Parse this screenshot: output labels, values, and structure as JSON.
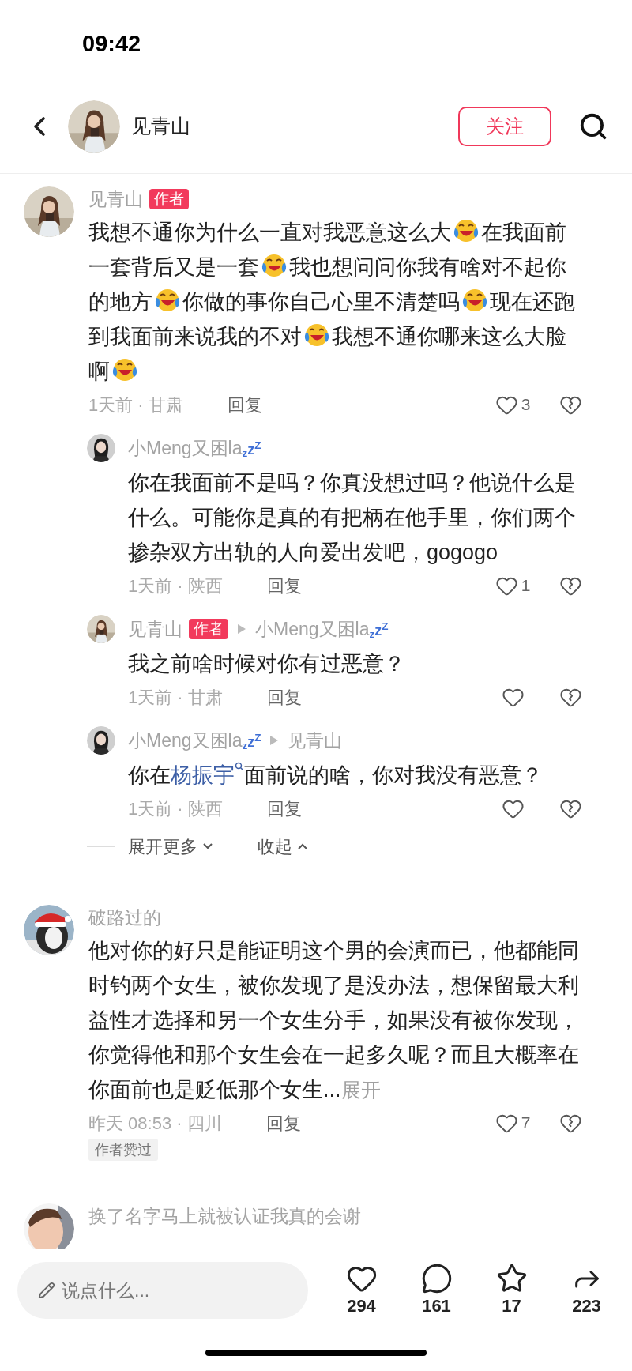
{
  "status_bar": {
    "time": "09:42"
  },
  "header": {
    "author": "见青山",
    "follow_button": "关注"
  },
  "comments": [
    {
      "author": "见青山",
      "author_badge": "作者",
      "body": [
        {
          "kind": "text",
          "text": "我想不通你为什么一直对我恶意这么大"
        },
        {
          "kind": "emoji"
        },
        {
          "kind": "text",
          "text": "在我面前一套背后又是一套"
        },
        {
          "kind": "emoji"
        },
        {
          "kind": "text",
          "text": "我也想问问你我有啥对不起你的地方"
        },
        {
          "kind": "emoji"
        },
        {
          "kind": "text",
          "text": "你做的事你自己心里不清楚吗"
        },
        {
          "kind": "emoji"
        },
        {
          "kind": "text",
          "text": "现在还跑到我面前来说我的不对"
        },
        {
          "kind": "emoji"
        },
        {
          "kind": "text",
          "text": "我想不通你哪来这么大脸啊"
        },
        {
          "kind": "emoji"
        }
      ],
      "meta": "1天前 · 甘肃",
      "reply_button": "回复",
      "likes": "3",
      "replies": [
        {
          "author": "小Meng又困la",
          "author_suffix": "$_{z}$z$^{Z}$",
          "body": [
            {
              "kind": "text",
              "text": "你在我面前不是吗？你真没想过吗？他说什么是什么。可能你是真的有把柄在他手里，你们两个掺杂双方出轨的人向爱出发吧，gogogo"
            }
          ],
          "meta": "1天前 · 陕西",
          "reply_button": "回复",
          "likes": "1"
        },
        {
          "author": "见青山",
          "author_badge": "作者",
          "reply_to": {
            "author": "小Meng又困la",
            "author_suffix": "$_{z}$z$^{Z}$"
          },
          "body": [
            {
              "kind": "text",
              "text": "我之前啥时候对你有过恶意？"
            }
          ],
          "meta": "1天前 · 甘肃",
          "reply_button": "回复"
        },
        {
          "author": "小Meng又困la",
          "author_suffix": "$_{z}$z$^{Z}$",
          "reply_to": {
            "author": "见青山"
          },
          "body": [
            {
              "kind": "text",
              "text": "你在"
            },
            {
              "kind": "link",
              "text": "杨振宇"
            },
            {
              "kind": "text",
              "text": "面前说的啥，你对我没有恶意？"
            }
          ],
          "meta": "1天前 · 陕西",
          "reply_button": "回复"
        }
      ],
      "expand": "展开更多",
      "collapse": "收起"
    },
    {
      "author": "破路过的",
      "body": [
        {
          "kind": "text",
          "text": "他对你的好只是能证明这个男的会演而已，他都能同时钓两个女生，被你发现了是没办法，想保留最大利益性才选择和另一个女生分手，如果没有被你发现，你觉得他和那个女生会在一起多久呢？而且大概率在你面前也是贬低那个女生..."
        },
        {
          "kind": "more",
          "text": "展开"
        }
      ],
      "meta": "昨天 08:53 · 四川",
      "reply_button": "回复",
      "likes": "7",
      "liked_by_author": "作者赞过"
    },
    {
      "author": "换了名字马上就被认证我真的会谢"
    }
  ],
  "composer": {
    "placeholder": "说点什么..."
  },
  "actions": [
    {
      "kind": "like",
      "count": "294"
    },
    {
      "kind": "comment",
      "count": "161"
    },
    {
      "kind": "favorite",
      "count": "17"
    },
    {
      "kind": "share",
      "count": "223"
    }
  ]
}
